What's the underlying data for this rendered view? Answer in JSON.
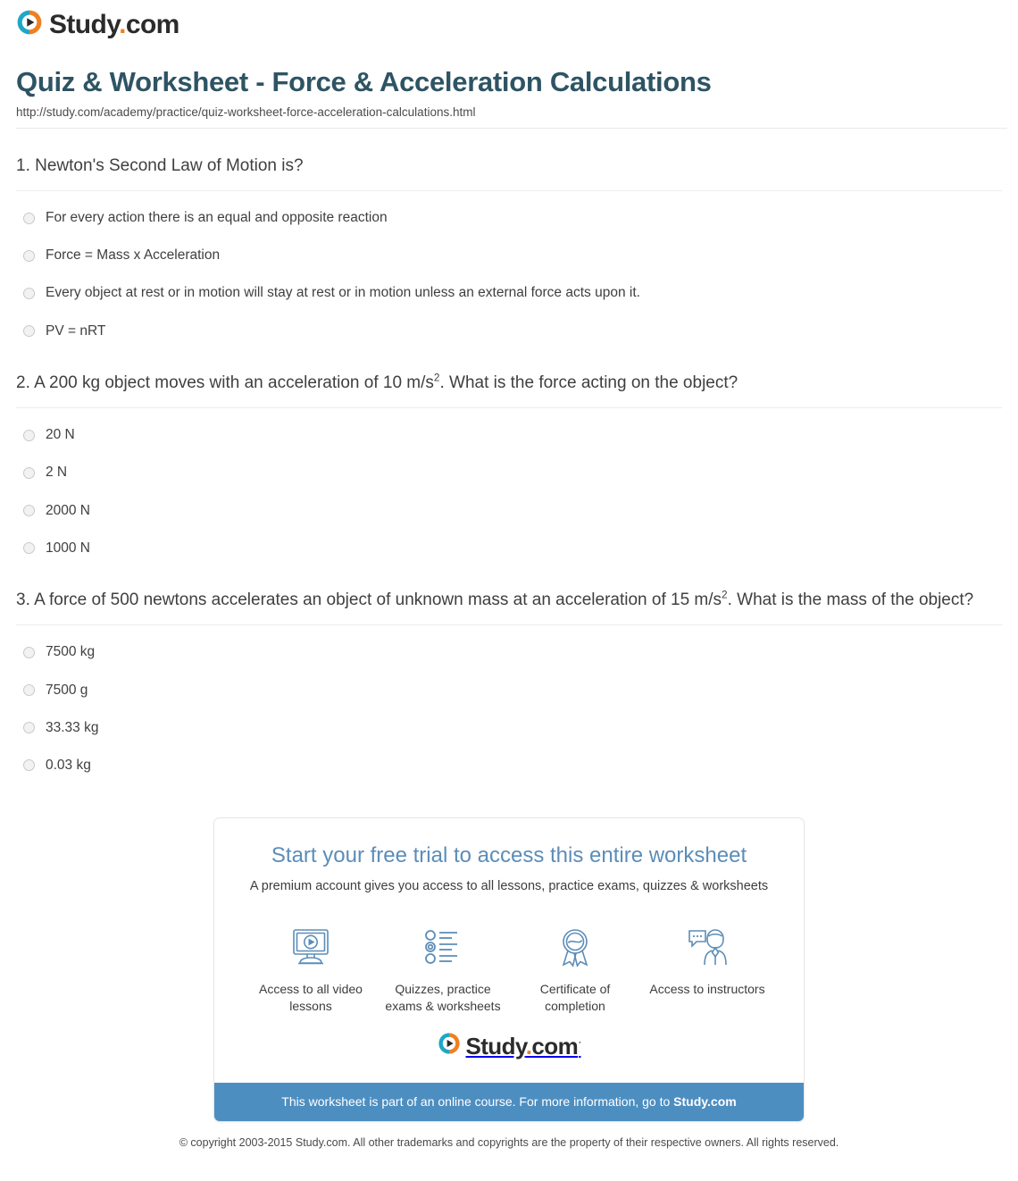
{
  "header": {
    "logo_text_main": "Study",
    "logo_text_dot": ".",
    "logo_text_tld": "com"
  },
  "page": {
    "title": "Quiz & Worksheet - Force & Acceleration Calculations",
    "url": "http://study.com/academy/practice/quiz-worksheet-force-acceleration-calculations.html"
  },
  "questions": [
    {
      "number": "1.",
      "text_before": "Newton's Second Law of Motion is?",
      "superscript": "",
      "text_after": "",
      "options": [
        "For every action there is an equal and opposite reaction",
        "Force = Mass x Acceleration",
        "Every object at rest or in motion will stay at rest or in motion unless an external force acts upon it.",
        "PV = nRT"
      ]
    },
    {
      "number": "2.",
      "text_before": "A 200 kg object moves with an acceleration of 10 m/s",
      "superscript": "2",
      "text_after": ". What is the force acting on the object?",
      "options": [
        "20 N",
        "2 N",
        "2000 N",
        "1000 N"
      ]
    },
    {
      "number": "3.",
      "text_before": "A force of 500 newtons accelerates an object of unknown mass at an acceleration of 15 m/s",
      "superscript": "2",
      "text_after": ". What is the mass of the object?",
      "options": [
        "7500 kg",
        "7500 g",
        "33.33 kg",
        "0.03 kg"
      ]
    }
  ],
  "promo": {
    "title": "Start your free trial to access this entire worksheet",
    "subtitle": "A premium account gives you access to all lessons, practice exams, quizzes & worksheets",
    "features": [
      {
        "icon": "monitor-play-icon",
        "label": "Access to all video lessons"
      },
      {
        "icon": "checklist-icon",
        "label": "Quizzes, practice exams & worksheets"
      },
      {
        "icon": "award-ribbon-icon",
        "label": "Certificate of completion"
      },
      {
        "icon": "instructor-chat-icon",
        "label": "Access to instructors"
      }
    ],
    "logo_text_main": "Study",
    "logo_text_dot": ".",
    "logo_text_tld": "com",
    "trademark": "·",
    "bar_text": "This worksheet is part of an online course. For more information, go to ",
    "bar_link": "Study.com"
  },
  "footer": {
    "copyright_line1": "© copyright 2003-2015 Study.com. All other trademarks and copyrights are the property of their respective owners.",
    "copyright_line2": "All rights reserved."
  },
  "colors": {
    "title": "#2e5464",
    "promo_title": "#5b8db8",
    "promo_bar": "#4d8ec1",
    "logo_orange": "#ef8022",
    "logo_teal": "#1fa7c4"
  }
}
